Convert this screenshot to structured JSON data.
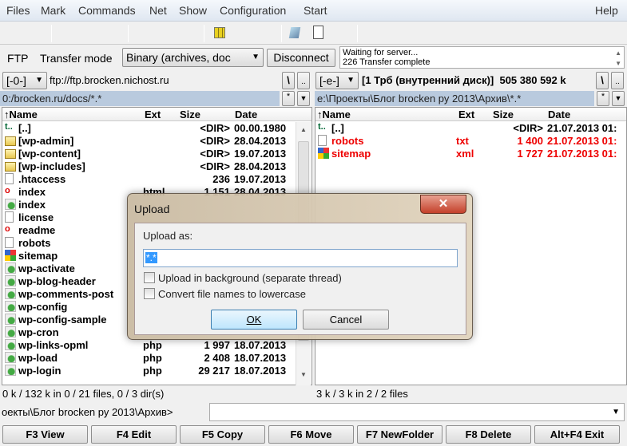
{
  "menu": [
    "Files",
    "Mark",
    "Commands",
    "Net",
    "Show",
    "Configuration",
    "Start",
    "Help"
  ],
  "ftp": {
    "label": "FTP",
    "transfer_mode_label": "Transfer mode",
    "transfer_mode": "Binary (archives, doc",
    "disconnect": "Disconnect",
    "log": [
      "Waiting for server...",
      "226 Transfer complete"
    ]
  },
  "left": {
    "drive": "[-0-]",
    "location": "ftp://ftp.brocken.nichost.ru",
    "path": "0:/brocken.ru/docs/*.*",
    "status": "0 k / 132 k in 0 / 21 files, 0 / 3 dir(s)",
    "columns": [
      "↑Name",
      "Ext",
      "Size",
      "Date"
    ],
    "rows": [
      {
        "name": "[..]",
        "ext": "",
        "size": "<DIR>",
        "date": "00.00.1980",
        "icon": "up-dir"
      },
      {
        "name": "[wp-admin]",
        "ext": "",
        "size": "<DIR>",
        "date": "28.04.2013",
        "icon": "folder"
      },
      {
        "name": "[wp-content]",
        "ext": "",
        "size": "<DIR>",
        "date": "19.07.2013",
        "icon": "folder"
      },
      {
        "name": "[wp-includes]",
        "ext": "",
        "size": "<DIR>",
        "date": "28.04.2013",
        "icon": "folder"
      },
      {
        "name": ".htaccess",
        "ext": "",
        "size": "236",
        "date": "19.07.2013",
        "icon": "file"
      },
      {
        "name": "index",
        "ext": "html",
        "size": "1 151",
        "date": "28.04.2013",
        "icon": "opera"
      },
      {
        "name": "index",
        "ext": "",
        "size": "",
        "date": "",
        "icon": "php"
      },
      {
        "name": "license",
        "ext": "",
        "size": "",
        "date": "",
        "icon": "text"
      },
      {
        "name": "readme",
        "ext": "",
        "size": "",
        "date": "",
        "icon": "opera"
      },
      {
        "name": "robots",
        "ext": "",
        "size": "",
        "date": "",
        "icon": "text"
      },
      {
        "name": "sitemap",
        "ext": "",
        "size": "",
        "date": "",
        "icon": "xml"
      },
      {
        "name": "wp-activate",
        "ext": "",
        "size": "",
        "date": "",
        "icon": "php"
      },
      {
        "name": "wp-blog-header",
        "ext": "",
        "size": "",
        "date": "",
        "icon": "php"
      },
      {
        "name": "wp-comments-post",
        "ext": "",
        "size": "",
        "date": "",
        "icon": "php"
      },
      {
        "name": "wp-config",
        "ext": "",
        "size": "",
        "date": "",
        "icon": "php"
      },
      {
        "name": "wp-config-sample",
        "ext": "",
        "size": "",
        "date": "",
        "icon": "php"
      },
      {
        "name": "wp-cron",
        "ext": "",
        "size": "",
        "date": "",
        "icon": "php"
      },
      {
        "name": "wp-links-opml",
        "ext": "php",
        "size": "1 997",
        "date": "18.07.2013",
        "icon": "php"
      },
      {
        "name": "wp-load",
        "ext": "php",
        "size": "2 408",
        "date": "18.07.2013",
        "icon": "php"
      },
      {
        "name": "wp-login",
        "ext": "php",
        "size": "29 217",
        "date": "18.07.2013",
        "icon": "php"
      }
    ]
  },
  "right": {
    "drive": "[-e-]",
    "location": "[1 Трб (внутренний диск)]  505 380 592 k",
    "path": "e:\\Проекты\\Блог brocken ру 2013\\Архив\\*.*",
    "status": "3 k / 3 k in 2 / 2 files",
    "columns": [
      "↑Name",
      "Ext",
      "Size",
      "Date"
    ],
    "rows": [
      {
        "name": "[..]",
        "ext": "",
        "size": "<DIR>",
        "date": "21.07.2013 01:",
        "icon": "up-dir",
        "selected": false
      },
      {
        "name": "robots",
        "ext": "txt",
        "size": "1 400",
        "date": "21.07.2013 01:",
        "icon": "text",
        "selected": true
      },
      {
        "name": "sitemap",
        "ext": "xml",
        "size": "1 727",
        "date": "21.07.2013 01:",
        "icon": "xml",
        "selected": true
      }
    ]
  },
  "cmdline": {
    "prompt": "оекты\\Блог brocken ру 2013\\Архив>",
    "value": ""
  },
  "fkeys": [
    "F3 View",
    "F4 Edit",
    "F5 Copy",
    "F6 Move",
    "F7 NewFolder",
    "F8 Delete",
    "Alt+F4 Exit"
  ],
  "dialog": {
    "title": "Upload",
    "label": "Upload as:",
    "value": "*.*",
    "options": [
      {
        "label": "Upload in background (separate thread)",
        "checked": false
      },
      {
        "label": "Convert file names to lowercase",
        "checked": false
      }
    ],
    "ok": "OK",
    "cancel": "Cancel"
  },
  "colors": {
    "selected": "#ee0000",
    "path_bar": "#b9cade"
  }
}
